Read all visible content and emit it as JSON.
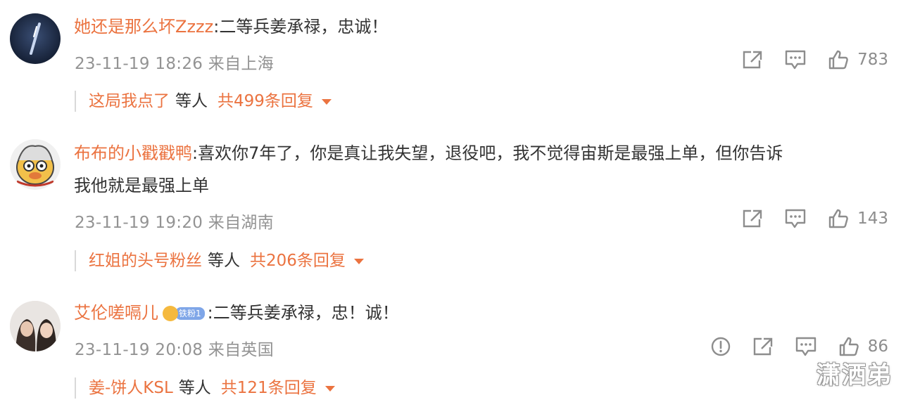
{
  "comments": [
    {
      "username": "她还是那么坏Zzzz",
      "text": ":二等兵姜承禄，忠诚！",
      "text2": "",
      "meta": "23-11-19 18:26 来自上海",
      "likes": "783",
      "reply_name": "这局我点了",
      "reply_etc": "等人",
      "reply_count": "共499条回复"
    },
    {
      "username": "布布的小戳戳鸭",
      "text": ":喜欢你7年了，你是真让我失望，退役吧，我不觉得宙斯是最强上单，但你告诉",
      "text2": "我他就是最强上单",
      "meta": "23-11-19 19:20 来自湖南",
      "likes": "143",
      "reply_name": "红姐的头号粉丝",
      "reply_etc": "等人",
      "reply_count": "共206条回复"
    },
    {
      "username": "艾伦嗟嗝儿",
      "badge": "铁粉1",
      "text": ":二等兵姜承禄，忠！诚！",
      "text2": "",
      "meta": "23-11-19 20:08 来自英国",
      "likes": "86",
      "reply_name": "姜-饼人KSL",
      "reply_etc": "等人",
      "reply_count": "共121条回复"
    }
  ],
  "icons": {
    "share": "share-icon",
    "comment": "comment-icon",
    "like": "thumbs-up-icon",
    "report": "report-icon"
  },
  "colors": {
    "username": "#eb7340",
    "meta": "#939393",
    "text": "#333333"
  },
  "watermark": "潇洒弟"
}
